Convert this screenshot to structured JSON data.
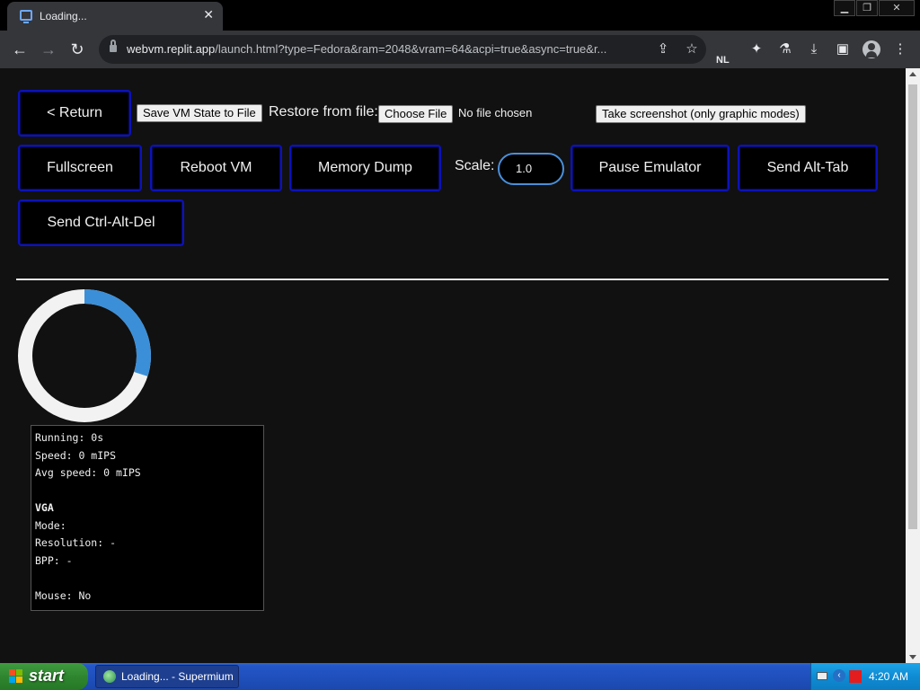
{
  "browser": {
    "tab_title": "Loading...",
    "tab_close": "✕",
    "window_controls": [
      "▁",
      "❐",
      "✕"
    ],
    "url_host": "webvm.replit.app",
    "url_rest": "/launch.html?type=Fedora&ram=2048&vram=64&acpi=true&async=true&r...",
    "extension_badge": "NL"
  },
  "vm_controls": {
    "return_label": "< Return",
    "save_state_label": "Save VM State to File",
    "restore_label": "Restore from file:",
    "choose_file_label": "Choose File",
    "no_file_label": "No file chosen",
    "screenshot_label": "Take screenshot (only graphic modes)",
    "fullscreen_label": "Fullscreen",
    "reboot_label": "Reboot VM",
    "memory_dump_label": "Memory Dump",
    "scale_label": "Scale:",
    "scale_value": "1.0",
    "pause_label": "Pause Emulator",
    "alt_tab_label": "Send Alt-Tab",
    "ctrl_alt_del_label": "Send Ctrl-Alt-Del"
  },
  "loading": {
    "progress": 0.3,
    "track_color": "#f2f2f2",
    "fill_color": "#3b8fd8"
  },
  "stats": {
    "running": "Running: 0s",
    "speed": "Speed: 0 mIPS",
    "avg_speed": "Avg speed: 0 mIPS",
    "vga_heading": "VGA",
    "mode": "Mode:",
    "resolution": "Resolution: -",
    "bpp": "BPP: -",
    "mouse": "Mouse: No"
  },
  "taskbar": {
    "start_label": "start",
    "task_label": "Loading... - Supermium",
    "clock": "4:20 AM"
  }
}
